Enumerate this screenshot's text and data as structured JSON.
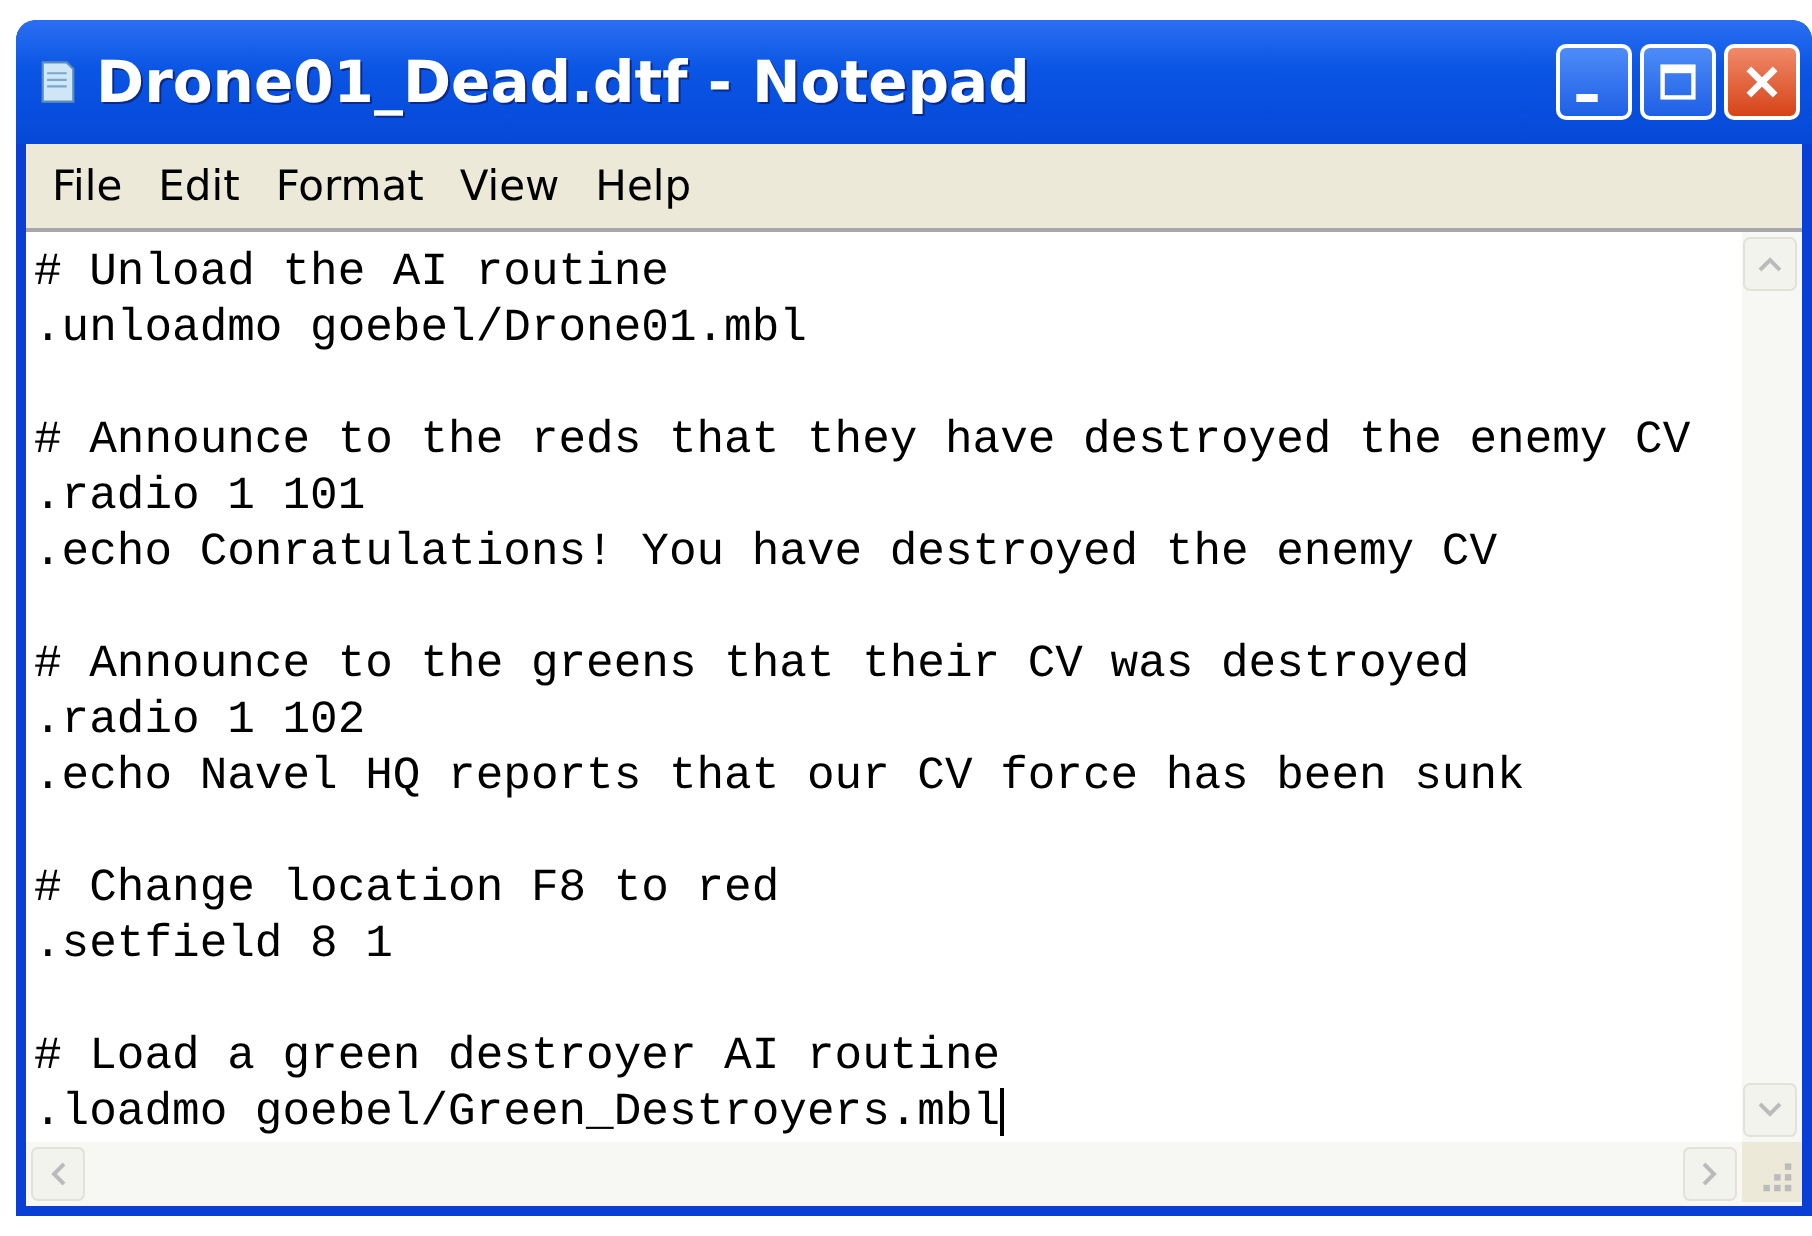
{
  "window": {
    "title": "Drone01_Dead.dtf - Notepad"
  },
  "menu": [
    "File",
    "Edit",
    "Format",
    "View",
    "Help"
  ],
  "editor": {
    "blocks": [
      [
        "# Unload the AI routine",
        ".unloadmo goebel/Drone01.mbl"
      ],
      [
        "# Announce to the reds that they have destroyed the enemy CV",
        ".radio 1 101",
        ".echo Conratulations! You have destroyed the enemy CV"
      ],
      [
        "# Announce to the greens that their CV was destroyed",
        ".radio 1 102",
        ".echo Navel HQ reports that our CV force has been sunk"
      ],
      [
        "# Change location F8 to red",
        ".setfield 8 1"
      ],
      [
        "# Load a green destroyer AI routine",
        ".loadmo goebel/Green_Destroyers.mbl"
      ]
    ]
  }
}
